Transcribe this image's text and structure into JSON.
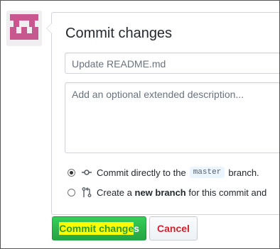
{
  "commit_form": {
    "title": "Commit changes",
    "summary_placeholder": "Update README.md",
    "description_placeholder": "Add an optional extended description...",
    "option_direct": {
      "checked": true,
      "text_before": "Commit directly to the",
      "branch": "master",
      "text_after": "branch."
    },
    "option_new_branch": {
      "checked": false,
      "text_before": "Create a",
      "bold": "new branch",
      "text_after": "for this commit and"
    },
    "commit_button": {
      "highlighted": "Commit change",
      "rest": "s"
    },
    "cancel_button": "Cancel"
  },
  "colors": {
    "commit_green": "#28a745",
    "cancel_red": "#cb2431",
    "highlight_yellow": "#ffff00",
    "avatar_pink": "#c8578f"
  },
  "icons": {
    "avatar": "identicon-avatar",
    "commit": "git-commit-icon",
    "branch": "git-pull-request-icon"
  }
}
